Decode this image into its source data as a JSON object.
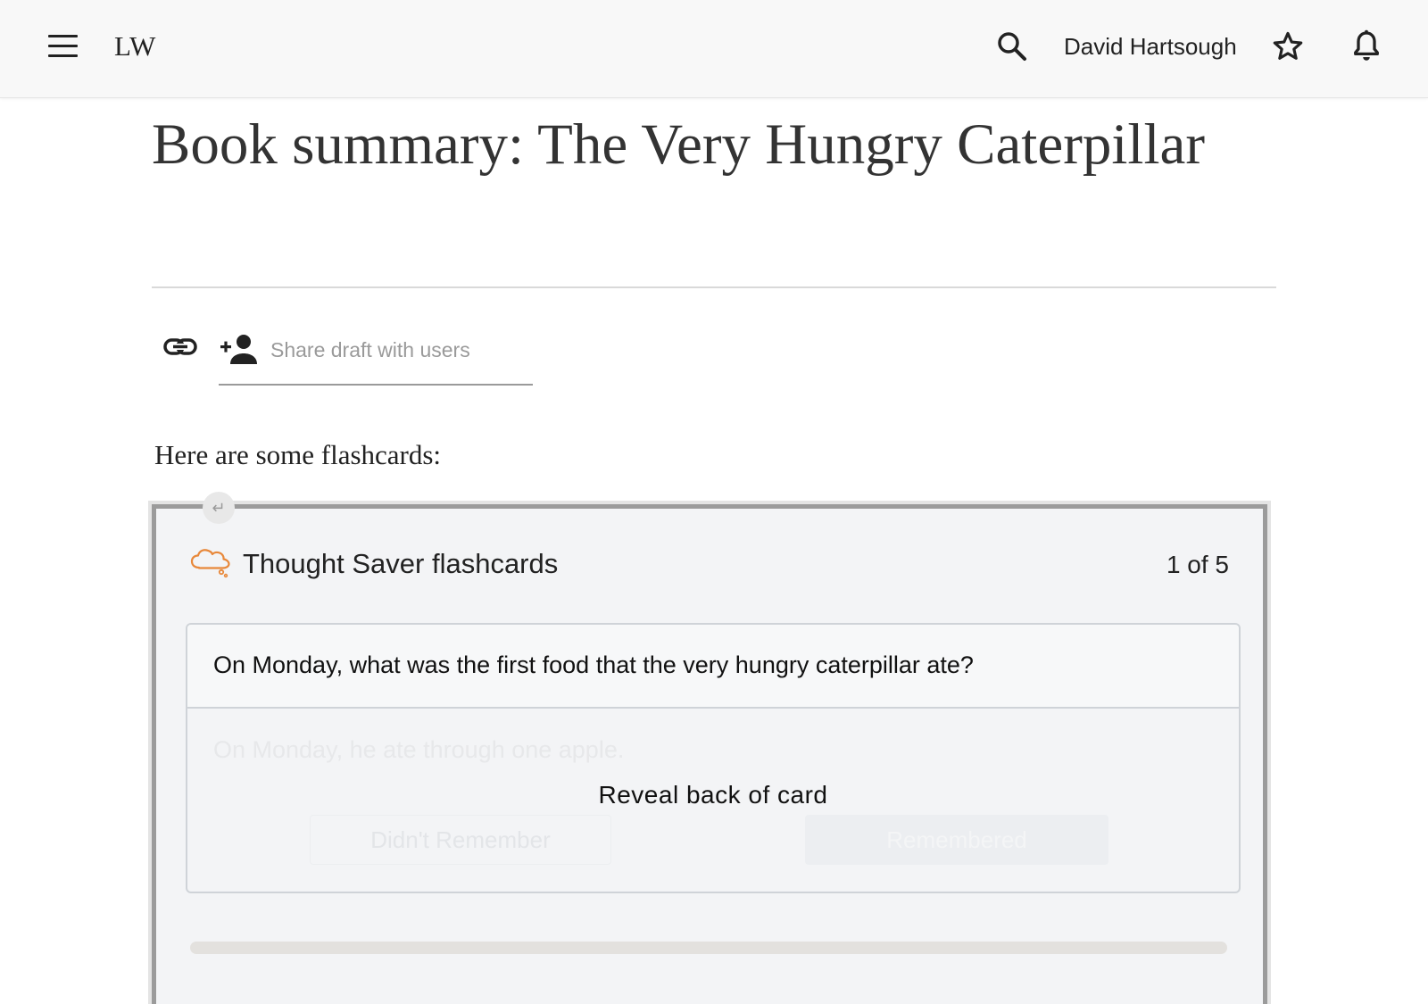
{
  "header": {
    "logo": "LW",
    "username": "David Hartsough"
  },
  "post": {
    "title": "Book summary: The Very Hungry Caterpillar",
    "share_placeholder": "Share draft with users",
    "intro": "Here are some flashcards:"
  },
  "flashcards": {
    "title": "Thought Saver flashcards",
    "counter": "1 of 5",
    "question": "On Monday, what was the first food that the very hungry caterpillar ate?",
    "answer": "On Monday, he ate through one apple.",
    "reveal_label": "Reveal back of card",
    "didnt_remember_label": "Didn't Remember",
    "remembered_label": "Remembered",
    "progress": 0
  },
  "colors": {
    "accent_orange": "#e8883a",
    "icon_dark": "#222222"
  },
  "icons": [
    "menu-icon",
    "search-icon",
    "star-icon",
    "bell-icon",
    "link-icon",
    "add-person-icon",
    "cloud-icon",
    "return-icon"
  ]
}
